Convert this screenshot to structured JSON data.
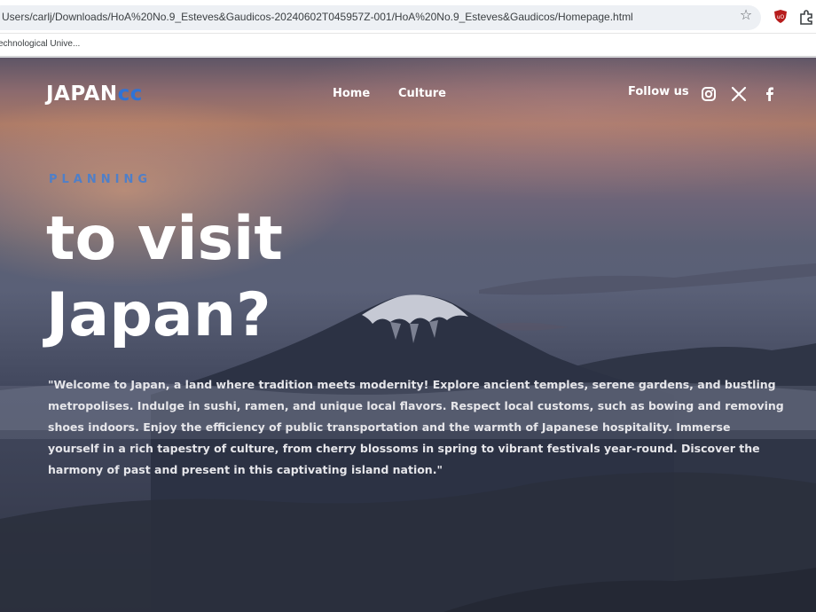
{
  "browser": {
    "url": "Users/carlj/Downloads/HoA%20No.9_Esteves&Gaudicos-20240602T045957Z-001/HoA%20No.9_Esteves&Gaudicos/Homepage.html",
    "bookmark_label": "echnological Unive..."
  },
  "site": {
    "logo_main": "JAPAN",
    "logo_accent": "cc",
    "nav": [
      {
        "label": "Home"
      },
      {
        "label": "Culture"
      }
    ],
    "follow_label": "Follow us",
    "social_icons": [
      "instagram-icon",
      "x-icon",
      "facebook-icon"
    ]
  },
  "hero": {
    "kicker": "PLANNING",
    "headline_line1": "to visit",
    "headline_line2": "Japan?",
    "intro": "\"Welcome to Japan, a land where tradition meets modernity! Explore ancient temples, serene gardens, and bustling metropolises. Indulge in sushi, ramen, and unique local flavors. Respect local customs, such as bowing and removing shoes indoors. Enjoy the efficiency of public transportation and the warmth of Japanese hospitality. Immerse yourself in a rich tapestry of culture, from cherry blossoms in spring to vibrant festivals year-round. Discover the harmony of past and present in this captivating island nation.\""
  },
  "colors": {
    "accent_blue": "#2f73d6",
    "kicker_blue": "#4f7fc8"
  }
}
